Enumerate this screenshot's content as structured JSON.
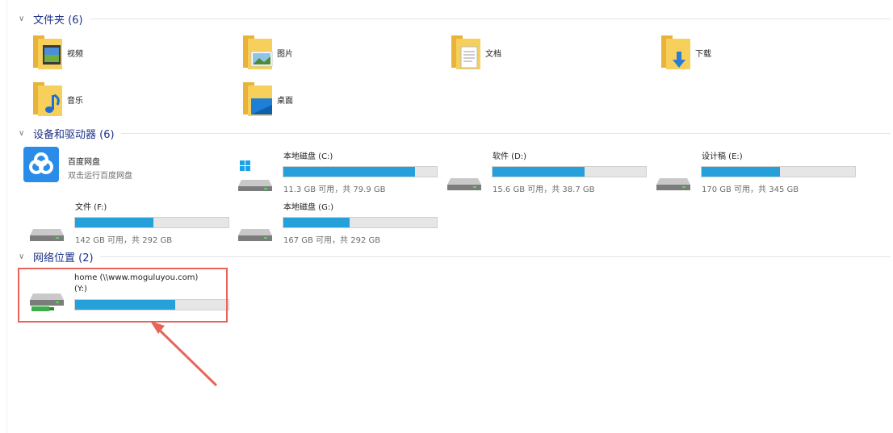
{
  "groups": {
    "folders": {
      "title": "文件夹 (6)"
    },
    "devices": {
      "title": "设备和驱动器 (6)"
    },
    "network": {
      "title": "网络位置 (2)"
    }
  },
  "folders": [
    {
      "label": "视频",
      "icon": "video-folder-icon"
    },
    {
      "label": "图片",
      "icon": "pictures-folder-icon"
    },
    {
      "label": "文档",
      "icon": "documents-folder-icon"
    },
    {
      "label": "下载",
      "icon": "downloads-folder-icon"
    },
    {
      "label": "音乐",
      "icon": "music-folder-icon"
    },
    {
      "label": "桌面",
      "icon": "desktop-folder-icon"
    }
  ],
  "baidu": {
    "name": "百度网盘",
    "subtitle": "双击运行百度网盘"
  },
  "drives": [
    {
      "name": "本地磁盘 (C:)",
      "free": "11.3 GB 可用，共 79.9 GB",
      "used_fraction": 0.86,
      "icon": "windows-drive-icon"
    },
    {
      "name": "软件 (D:)",
      "free": "15.6 GB 可用，共 38.7 GB",
      "used_fraction": 0.6,
      "icon": "drive-icon"
    },
    {
      "name": "设计稿 (E:)",
      "free": "170 GB 可用，共 345 GB",
      "used_fraction": 0.51,
      "icon": "drive-icon"
    },
    {
      "name": "文件 (F:)",
      "free": "142 GB 可用，共 292 GB",
      "used_fraction": 0.51,
      "icon": "drive-icon"
    },
    {
      "name": "本地磁盘 (G:)",
      "free": "167 GB 可用，共 292 GB",
      "used_fraction": 0.43,
      "icon": "drive-icon"
    }
  ],
  "network": {
    "name_line1": "home (\\\\www.moguluyou.com)",
    "name_line2": "(Y:)",
    "used_fraction": 0.65,
    "icon": "network-drive-icon"
  },
  "colors": {
    "accent": "#26a0da",
    "highlight": "#e8645a",
    "folder": "#f5c542"
  }
}
